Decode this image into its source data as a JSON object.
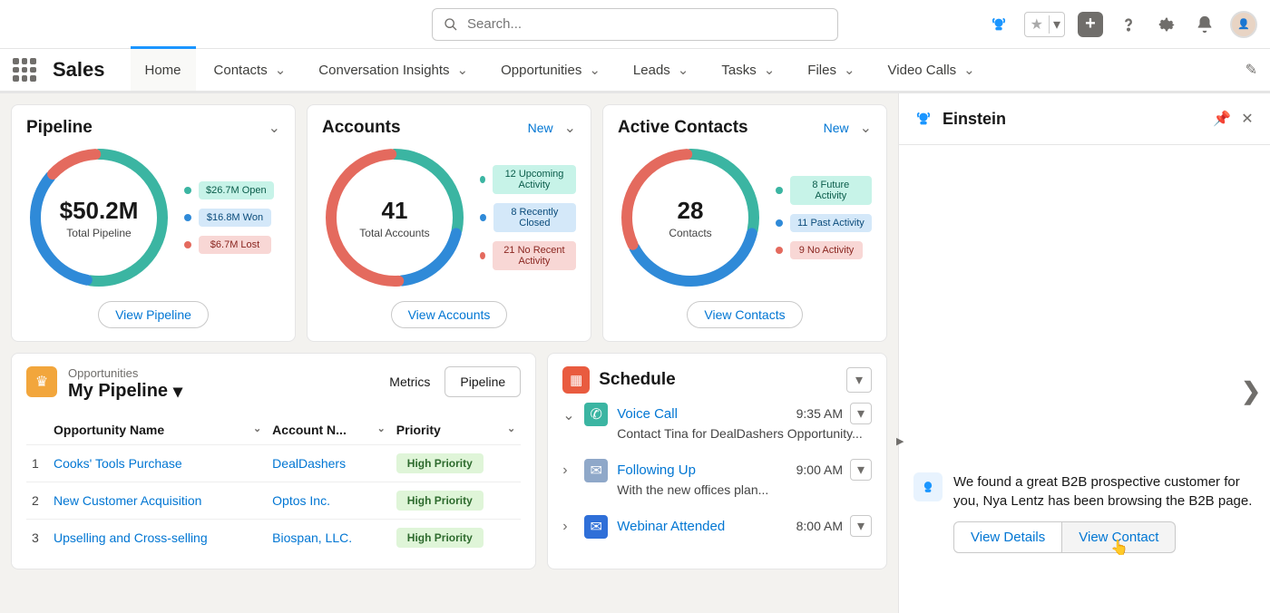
{
  "search": {
    "placeholder": "Search..."
  },
  "app": {
    "title": "Sales"
  },
  "nav": {
    "tabs": [
      {
        "label": "Home",
        "hasChevron": false,
        "active": true
      },
      {
        "label": "Contacts",
        "hasChevron": true
      },
      {
        "label": "Conversation Insights",
        "hasChevron": true
      },
      {
        "label": "Opportunities",
        "hasChevron": true
      },
      {
        "label": "Leads",
        "hasChevron": true
      },
      {
        "label": "Tasks",
        "hasChevron": true
      },
      {
        "label": "Files",
        "hasChevron": true
      },
      {
        "label": "Video Calls",
        "hasChevron": true
      }
    ]
  },
  "cards": {
    "pipeline": {
      "title": "Pipeline",
      "value": "$50.2M",
      "subtitle": "Total Pipeline",
      "legend": [
        {
          "label": "$26.7M Open",
          "color": "#3bb5a2",
          "pill": "pill-teal"
        },
        {
          "label": "$16.8M Won",
          "color": "#2f8ad8",
          "pill": "pill-blue"
        },
        {
          "label": "$6.7M Lost",
          "color": "#e46a5e",
          "pill": "pill-red"
        }
      ],
      "button": "View Pipeline"
    },
    "accounts": {
      "title": "Accounts",
      "new": "New",
      "value": "41",
      "subtitle": "Total Accounts",
      "legend": [
        {
          "label": "12 Upcoming Activity",
          "color": "#3bb5a2",
          "pill": "pill-teal"
        },
        {
          "label": "8 Recently Closed",
          "color": "#2f8ad8",
          "pill": "pill-blue"
        },
        {
          "label": "21 No Recent Activity",
          "color": "#e46a5e",
          "pill": "pill-red"
        }
      ],
      "button": "View Accounts"
    },
    "contacts": {
      "title": "Active Contacts",
      "new": "New",
      "value": "28",
      "subtitle": "Contacts",
      "legend": [
        {
          "label": "8 Future Activity",
          "color": "#3bb5a2",
          "pill": "pill-teal"
        },
        {
          "label": "11 Past Activity",
          "color": "#2f8ad8",
          "pill": "pill-blue"
        },
        {
          "label": "9 No Activity",
          "color": "#e46a5e",
          "pill": "pill-red"
        }
      ],
      "button": "View Contacts"
    }
  },
  "opportunities": {
    "subtitle": "Opportunities",
    "title": "My Pipeline",
    "segments": {
      "metrics": "Metrics",
      "pipeline": "Pipeline"
    },
    "columns": {
      "name": "Opportunity Name",
      "account": "Account N...",
      "priority": "Priority"
    },
    "rows": [
      {
        "idx": "1",
        "name": "Cooks' Tools Purchase",
        "account": "DealDashers",
        "priority": "High Priority"
      },
      {
        "idx": "2",
        "name": "New Customer Acquisition",
        "account": "Optos Inc.",
        "priority": "High Priority"
      },
      {
        "idx": "3",
        "name": "Upselling and Cross-selling",
        "account": "Biospan, LLC.",
        "priority": "High Priority"
      }
    ]
  },
  "schedule": {
    "title": "Schedule",
    "items": [
      {
        "name": "Voice Call",
        "time": "9:35 AM",
        "desc": "Contact Tina for DealDashers Opportunity...",
        "color": "#3bb5a2",
        "expanded": true
      },
      {
        "name": "Following Up",
        "time": "9:00 AM",
        "desc": "With the new offices plan...",
        "color": "#8fa8c9",
        "expanded": false
      },
      {
        "name": "Webinar Attended",
        "time": "8:00 AM",
        "desc": "",
        "color": "#2f6fd8",
        "expanded": false
      }
    ]
  },
  "einstein": {
    "title": "Einstein",
    "message": "We found a great B2B prospective customer for you, Nya Lentz has been browsing the B2B page.",
    "buttons": {
      "details": "View Details",
      "contact": "View Contact"
    }
  }
}
